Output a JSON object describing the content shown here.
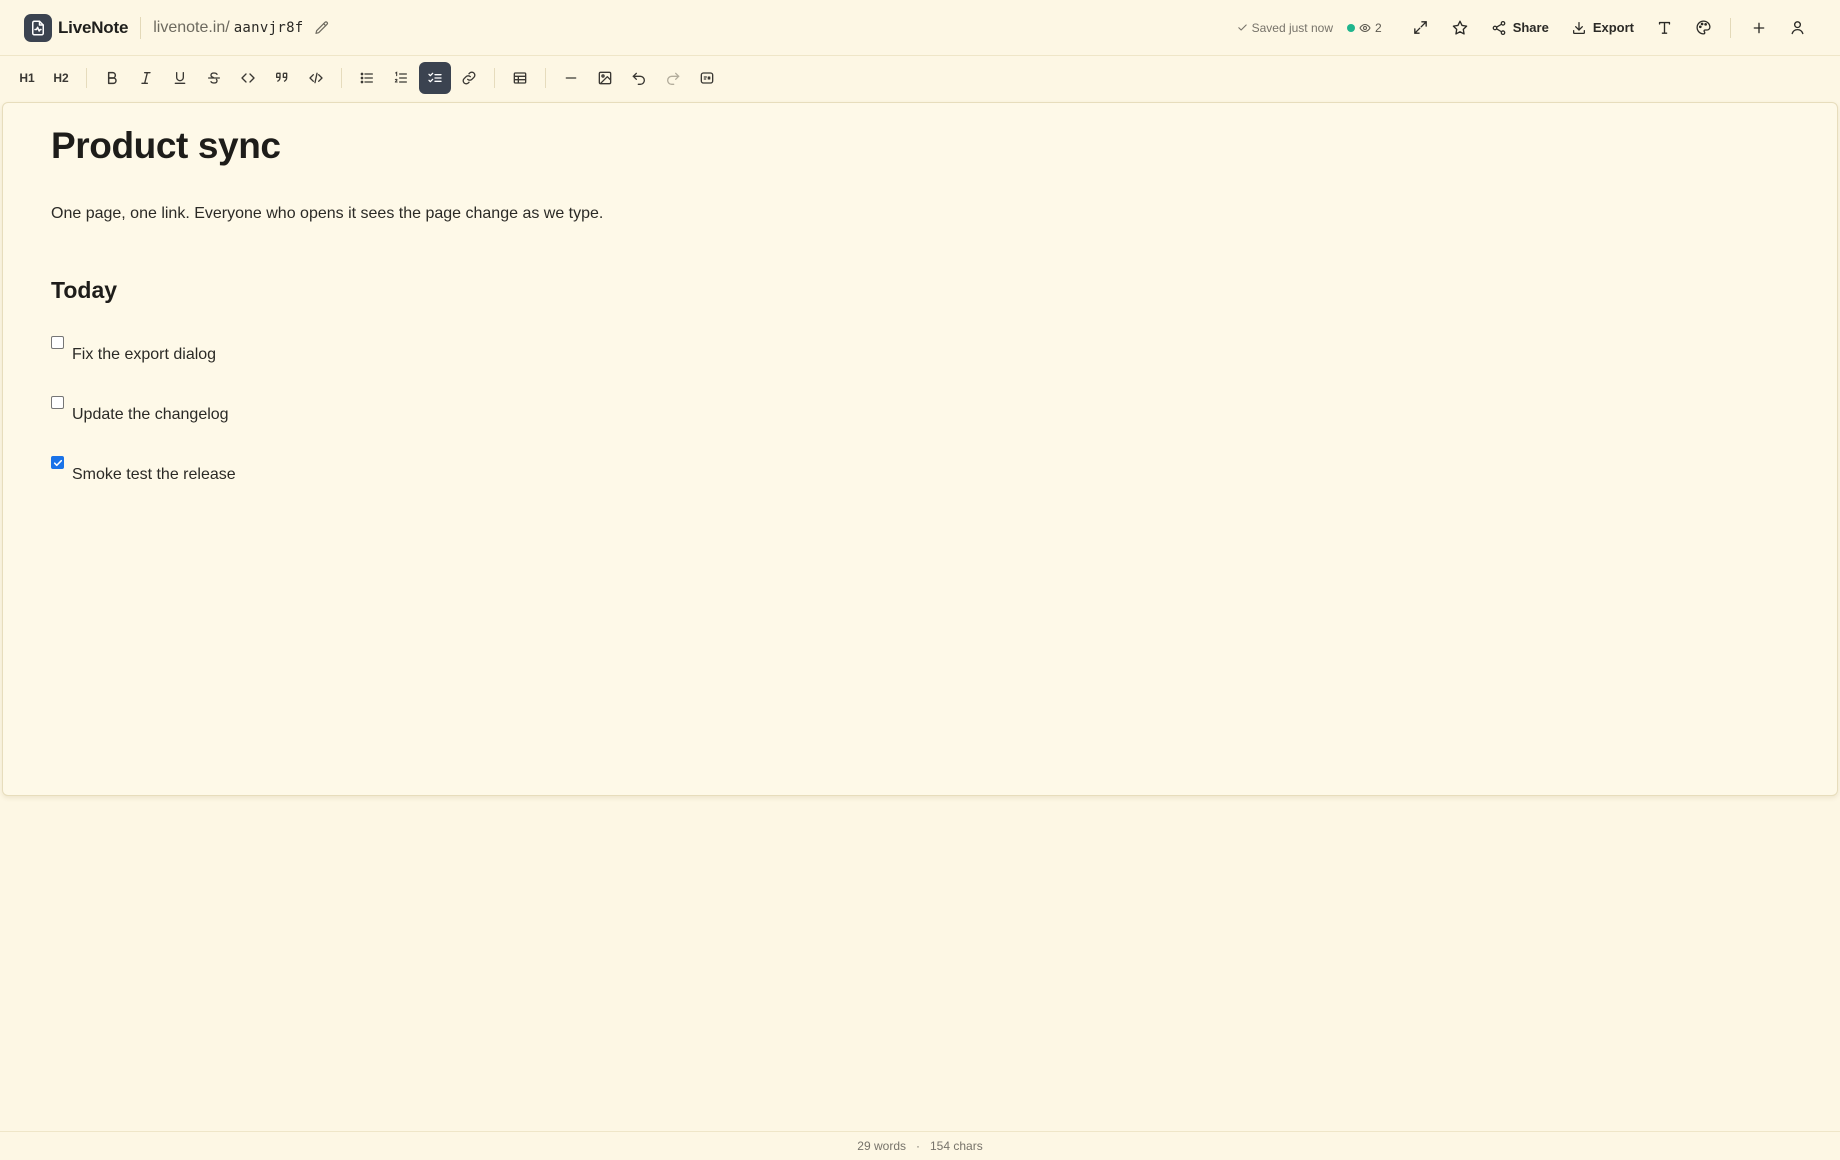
{
  "header": {
    "app_name": "LiveNote",
    "domain": "livenote.in/",
    "slug": "aanvjr8f",
    "save_status": "Saved just now",
    "viewer_count": "2",
    "share_label": "Share",
    "export_label": "Export"
  },
  "toolbar": {
    "h1_label": "H1",
    "h2_label": "H2",
    "active_tool": "task-list"
  },
  "document": {
    "title": "Product sync",
    "intro": "One page, one link. Everyone who opens it sees the page change as we type.",
    "section_heading": "Today",
    "tasks": [
      {
        "label": "Fix the export dialog",
        "checked": false
      },
      {
        "label": "Update the changelog",
        "checked": false
      },
      {
        "label": "Smoke test the release",
        "checked": true
      }
    ]
  },
  "footer": {
    "words": "29 words",
    "separator": "·",
    "chars": "154 chars"
  },
  "colors": {
    "background": "#fdf7e4",
    "accent": "#3b4350",
    "presence": "#1fb58d",
    "checkbox_checked": "#1a73e8"
  }
}
